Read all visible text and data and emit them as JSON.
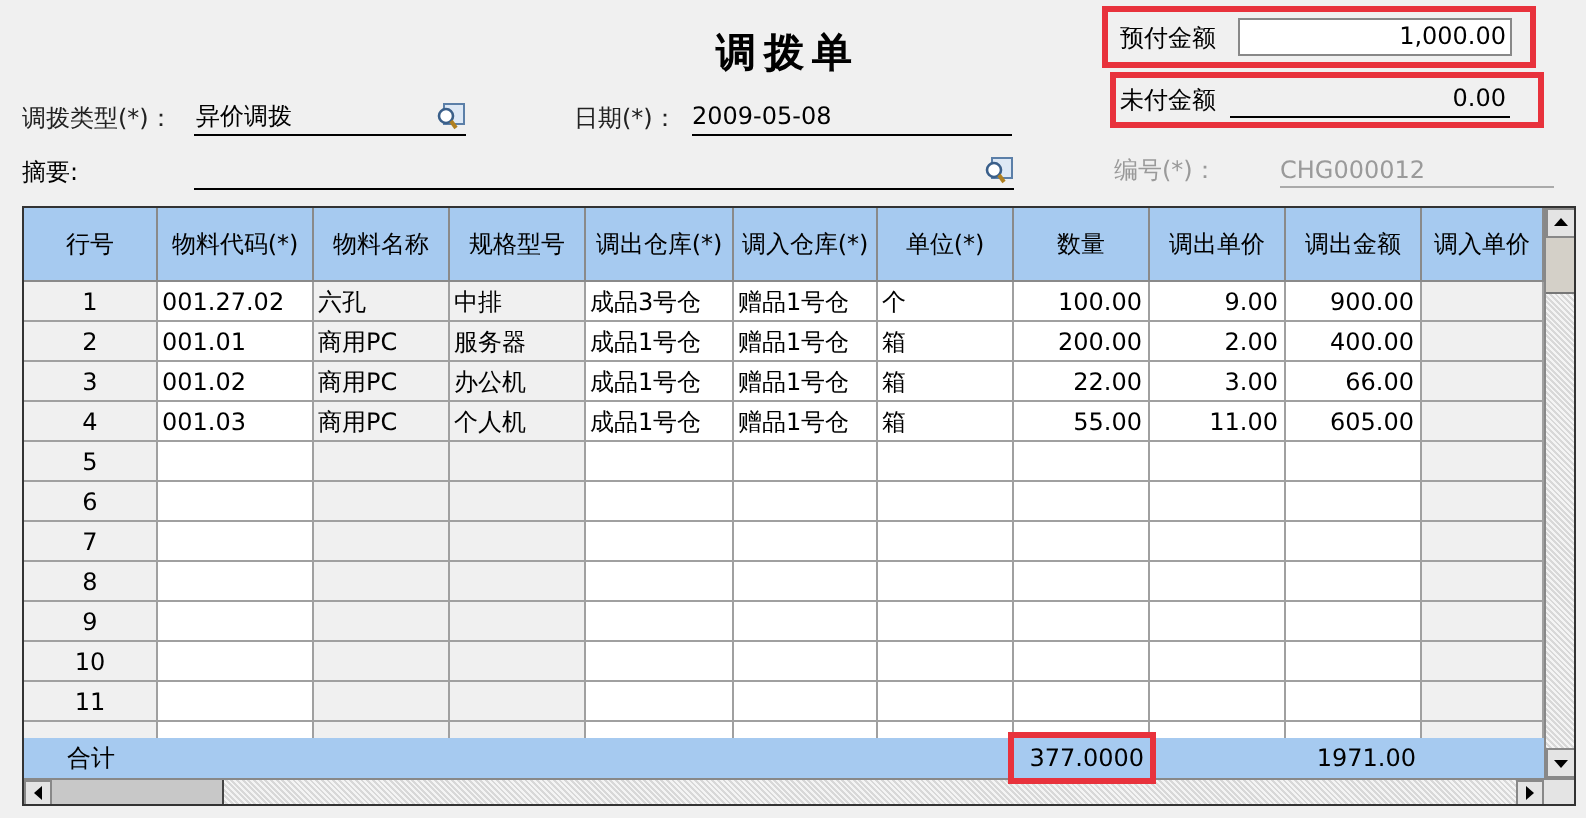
{
  "title": "调拨单",
  "prepaid": {
    "label": "预付金额",
    "value": "1,000.00",
    "highlighted": true
  },
  "unpaid": {
    "label": "未付金额",
    "value": "0.00",
    "highlighted": true
  },
  "transfer_type": {
    "label": "调拨类型(*)：",
    "value": "异价调拨"
  },
  "date": {
    "label": "日期(*)：",
    "value": "2009-05-08"
  },
  "summary": {
    "label": "摘要:"
  },
  "number": {
    "label": "编号(*)：",
    "value": "CHG000012",
    "disabled": true
  },
  "table": {
    "columns": [
      {
        "label": "行号",
        "kind": "rownum"
      },
      {
        "label": "物料代码(*)",
        "kind": "text",
        "readonly": false
      },
      {
        "label": "物料名称",
        "kind": "text",
        "readonly": true
      },
      {
        "label": "规格型号",
        "kind": "text",
        "readonly": true
      },
      {
        "label": "调出仓库(*)",
        "kind": "text",
        "readonly": false
      },
      {
        "label": "调入仓库(*)",
        "kind": "text",
        "readonly": false
      },
      {
        "label": "单位(*)",
        "kind": "text",
        "readonly": false
      },
      {
        "label": "数量",
        "kind": "number",
        "readonly": false
      },
      {
        "label": "调出单价",
        "kind": "number",
        "readonly": false
      },
      {
        "label": "调出金额",
        "kind": "number",
        "readonly": false
      },
      {
        "label": "调入单价",
        "kind": "number",
        "readonly": true
      }
    ],
    "rows": [
      {
        "no": "1",
        "cells": [
          "001.27.02",
          "六孔",
          "中排",
          "成品3号仓",
          "赠品1号仓",
          "个",
          "100.00",
          "9.00",
          "900.00"
        ]
      },
      {
        "no": "2",
        "cells": [
          "001.01",
          "商用PC",
          "服务器",
          "成品1号仓",
          "赠品1号仓",
          "箱",
          "200.00",
          "2.00",
          "400.00"
        ]
      },
      {
        "no": "3",
        "cells": [
          "001.02",
          "商用PC",
          "办公机",
          "成品1号仓",
          "赠品1号仓",
          "箱",
          "22.00",
          "3.00",
          "66.00"
        ]
      },
      {
        "no": "4",
        "cells": [
          "001.03",
          "商用PC",
          "个人机",
          "成品1号仓",
          "赠品1号仓",
          "箱",
          "55.00",
          "11.00",
          "605.00"
        ]
      },
      {
        "no": "5"
      },
      {
        "no": "6"
      },
      {
        "no": "7"
      },
      {
        "no": "8"
      },
      {
        "no": "9"
      },
      {
        "no": "10"
      },
      {
        "no": "11"
      }
    ],
    "totals": {
      "label": "合计",
      "quantity": {
        "value": "377.0000",
        "highlighted": true
      },
      "amount": "1971.00"
    }
  }
}
